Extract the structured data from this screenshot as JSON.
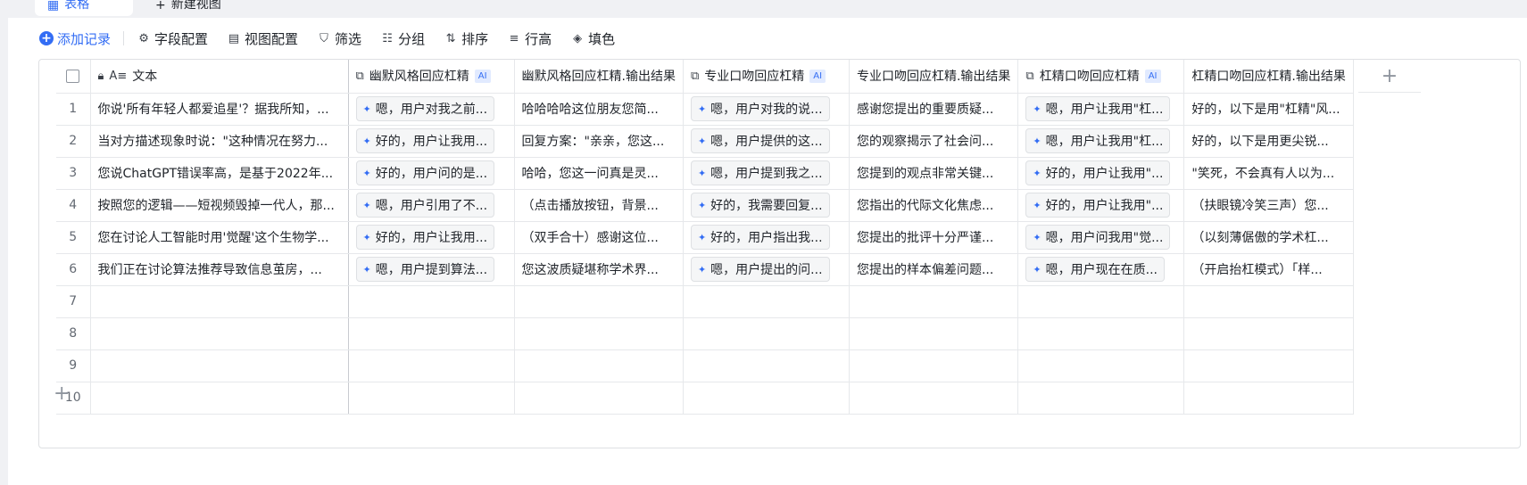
{
  "tabs": {
    "active_label": "表格",
    "new_view_label": "新建视图"
  },
  "toolbar": {
    "add_record": "添加记录",
    "field_config": "字段配置",
    "view_config": "视图配置",
    "filter": "筛选",
    "group": "分组",
    "sort": "排序",
    "row_height": "行高",
    "fill_color": "填色"
  },
  "columns": {
    "text": "文本",
    "c1": "幽默风格回应杠精",
    "c2": "幽默风格回应杠精.输出结果",
    "c3": "专业口吻回应杠精",
    "c4": "专业口吻回应杠精.输出结果",
    "c5": "杠精口吻回应杠精",
    "c6": "杠精口吻回应杠精.输出结果",
    "ai_badge": "AI"
  },
  "rows": [
    {
      "num": "1",
      "text": "你说'所有年轻人都爱追星'？据我所知，...",
      "c1": "嗯，用户对我之前...",
      "c2": "哈哈哈哈这位朋友您简...",
      "c3": "嗯，用户对我的说...",
      "c4": "感谢您提出的重要质疑...",
      "c5": "嗯，用户让我用\"杠...",
      "c6": "好的，以下是用\"杠精\"风..."
    },
    {
      "num": "2",
      "text": "当对方描述现象时说：\"这种情况在努力...",
      "c1": "好的，用户让我用...",
      "c2": "回复方案：\"亲亲，您这...",
      "c3": "嗯，用户提供的这...",
      "c4": "您的观察揭示了社会问...",
      "c5": "嗯，用户让我用\"杠...",
      "c6": "好的，以下是用更尖锐..."
    },
    {
      "num": "3",
      "text": "您说ChatGPT错误率高，是基于2022年...",
      "c1": "好的，用户问的是...",
      "c2": "哈哈，您这一问真是灵...",
      "c3": "嗯，用户提到我之...",
      "c4": "您提到的观点非常关键...",
      "c5": "好的，用户让我用\"...",
      "c6": "\"笑死，不会真有人以为..."
    },
    {
      "num": "4",
      "text": "按照您的逻辑——短视频毁掉一代人，那...",
      "c1": "嗯，用户引用了不...",
      "c2": "（点击播放按钮，背景...",
      "c3": "好的，我需要回复...",
      "c4": "您指出的代际文化焦虑...",
      "c5": "好的，用户让我用\"...",
      "c6": "（扶眼镜冷笑三声）您..."
    },
    {
      "num": "5",
      "text": "您在讨论人工智能时用'觉醒'这个生物学...",
      "c1": "好的，用户让我用...",
      "c2": "（双手合十）感谢这位...",
      "c3": "好的，用户指出我...",
      "c4": "您提出的批评十分严谨...",
      "c5": "嗯，用户问我用\"觉...",
      "c6": "（以刻薄倨傲的学术杠..."
    },
    {
      "num": "6",
      "text": "我们正在讨论算法推荐导致信息茧房，...",
      "c1": "嗯，用户提到算法...",
      "c2": "您这波质疑堪称学术界...",
      "c3": "嗯，用户提出的问...",
      "c4": "您提出的样本偏差问题...",
      "c5": "嗯，用户现在在质...",
      "c6": "（开启抬杠模式）「样..."
    }
  ],
  "empty_rows": [
    "7",
    "8",
    "9",
    "10"
  ],
  "icons": {
    "add": "plus-circle-icon",
    "field_config": "gear-icon",
    "view_config": "view-settings-icon",
    "filter": "filter-icon",
    "group": "group-icon",
    "sort": "sort-icon",
    "row_height": "row-height-icon",
    "fill": "paint-bucket-icon",
    "lock": "lock-icon",
    "text_field": "text-field-icon",
    "ai_field": "ai-field-icon",
    "ai_cell": "ai-sparkle-icon"
  },
  "accent_color": "#336df4"
}
